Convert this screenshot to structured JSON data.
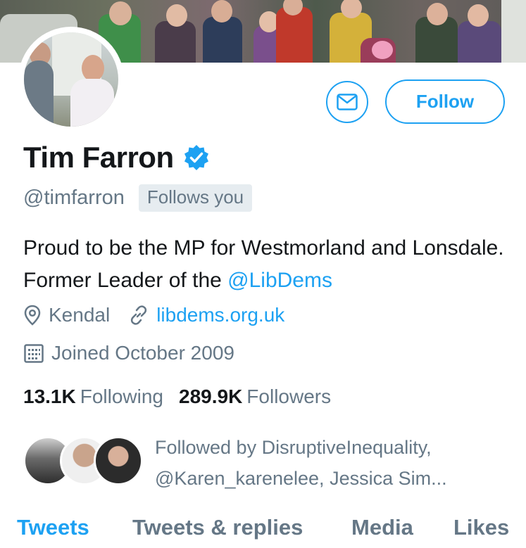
{
  "profile": {
    "name": "Tim Farron",
    "handle": "@timfarron",
    "follows_you": "Follows you",
    "bio_text": "Proud to be the MP for Westmorland and Lonsdale. Former Leader of the ",
    "bio_mention": "@LibDems",
    "location": "Kendal",
    "website": "libdems.org.uk",
    "joined": "Joined October 2009"
  },
  "actions": {
    "message_icon": "envelope-icon",
    "follow_label": "Follow"
  },
  "stats": {
    "following_count": "13.1K",
    "following_label": "Following",
    "followers_count": "289.9K",
    "followers_label": "Followers"
  },
  "followed_by": {
    "line1": "Followed by DisruptiveInequality,",
    "line2": "@Karen_karenelee, Jessica Sim..."
  },
  "tabs": [
    {
      "label": "Tweets",
      "active": true
    },
    {
      "label": "Tweets & replies",
      "active": false
    },
    {
      "label": "Media",
      "active": false
    },
    {
      "label": "Likes",
      "active": false
    }
  ],
  "colors": {
    "accent": "#1da1f2",
    "secondary_text": "#657786",
    "primary_text": "#14171a",
    "badge_bg": "#e6ecf0"
  }
}
